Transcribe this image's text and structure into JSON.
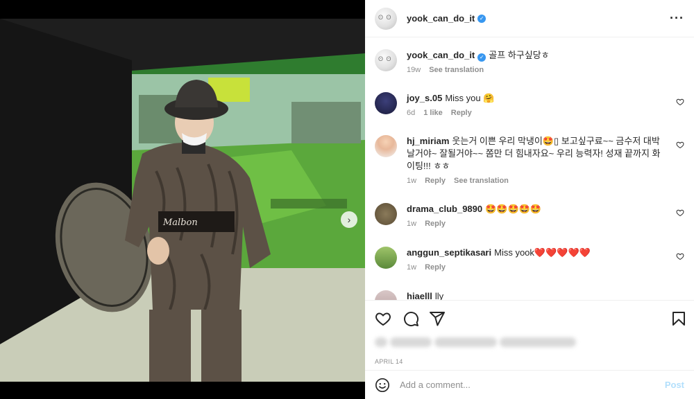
{
  "post": {
    "username": "yook_can_do_it",
    "verified": true,
    "caption": "골프 하구싶당ㅎ",
    "caption_age": "19w",
    "see_translation": "See translation",
    "date": "APRIL 14",
    "carousel": {
      "total": 3,
      "active_index": 0
    }
  },
  "comments": [
    {
      "username": "joy_s.05",
      "text": "Miss you 🤗",
      "age": "6d",
      "likes": "1 like",
      "reply": "Reply",
      "avatar_icon": "profile-avatar"
    },
    {
      "username": "hj_miriam",
      "text": "웃는거 이쁜 우리 막냉이🤩▯ 보고싶구료~~ 금수저 대박날거야~ 잘될거야~~ 쫌만 더 힘내자요~ 우리 능력자! 성재 끝까지 화이팅!!! ㅎㅎ",
      "age": "1w",
      "reply": "Reply",
      "see_translation": "See translation",
      "avatar_icon": "profile-avatar"
    },
    {
      "username": "drama_club_9890",
      "text": "🤩🤩🤩🤩🤩",
      "age": "1w",
      "reply": "Reply",
      "avatar_icon": "profile-avatar"
    },
    {
      "username": "anggun_septikasari",
      "text": "Miss yook❤️❤️❤️❤️❤️",
      "age": "1w",
      "reply": "Reply",
      "avatar_icon": "profile-avatar"
    },
    {
      "username": "hiaelll",
      "text": "lly",
      "avatar_icon": "profile-avatar"
    }
  ],
  "actions": {
    "like_icon": "heart-icon",
    "comment_icon": "comment-icon",
    "share_icon": "share-icon",
    "save_icon": "bookmark-icon"
  },
  "composer": {
    "placeholder": "Add a comment...",
    "post_label": "Post",
    "emoji_icon": "emoji-icon"
  },
  "colors": {
    "verified_blue": "#3897f0",
    "post_button_disabled": "#b2dffc",
    "muted_text": "#8e8e8e"
  }
}
